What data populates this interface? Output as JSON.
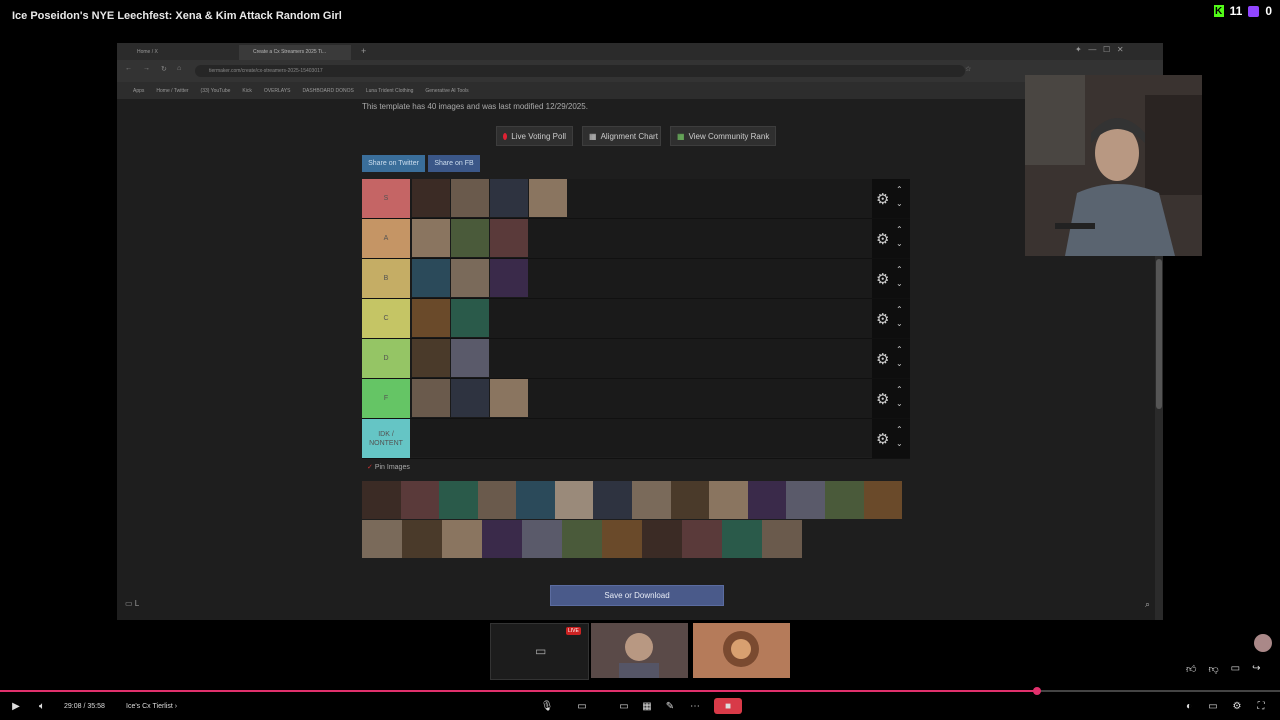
{
  "video": {
    "title": "Ice Poseidon's NYE Leechfest: Xena & Kim Attack Random Girl",
    "kick_count": "11",
    "twitch_count": "0",
    "time_current": "29:08",
    "time_total": "35:58",
    "time_display": "29:08 / 35:58",
    "chapter": "Ice's Cx Tierlist",
    "progress_fraction": 0.81,
    "live_badge": "LIVE"
  },
  "browser": {
    "tabs": [
      {
        "label": "Home / X"
      },
      {
        "label": "Create a Cx Streamers 2025 Ti..."
      }
    ],
    "address": "tiermaker.com/create/cx-streamers-2025-15403017",
    "bookmarks": [
      "Apps",
      "Home / Twitter",
      "(33) YouTube",
      "Kick",
      "OVERLAYS",
      "DASHBOARD DONOS",
      "Luna Trident Clothing",
      "Generative AI Tools"
    ]
  },
  "page": {
    "template_note": "This template has 40 images and was last modified 12/29/2025.",
    "buttons": {
      "live_poll": "Live Voting Poll",
      "alignment": "Alignment Chart",
      "community": "View Community Rank",
      "share_twitter": "Share on Twitter",
      "share_fb": "Share on FB"
    },
    "pool_label": "Pin Images",
    "save_label": "Save or Download"
  },
  "tiers": [
    {
      "label": "S",
      "color": "#ff7f7f",
      "items": 4
    },
    {
      "label": "A",
      "color": "#ffbf7f",
      "items": 3
    },
    {
      "label": "B",
      "color": "#ffdf7f",
      "items": 3
    },
    {
      "label": "C",
      "color": "#ffff7f",
      "items": 2
    },
    {
      "label": "D",
      "color": "#bfff7f",
      "items": 2
    },
    {
      "label": "F",
      "color": "#7fff7f",
      "items": 3
    },
    {
      "label": "IDK / NONTENT",
      "color": "#7fffff",
      "items": 0
    }
  ],
  "pool": {
    "row1": 14,
    "row2": 11
  }
}
